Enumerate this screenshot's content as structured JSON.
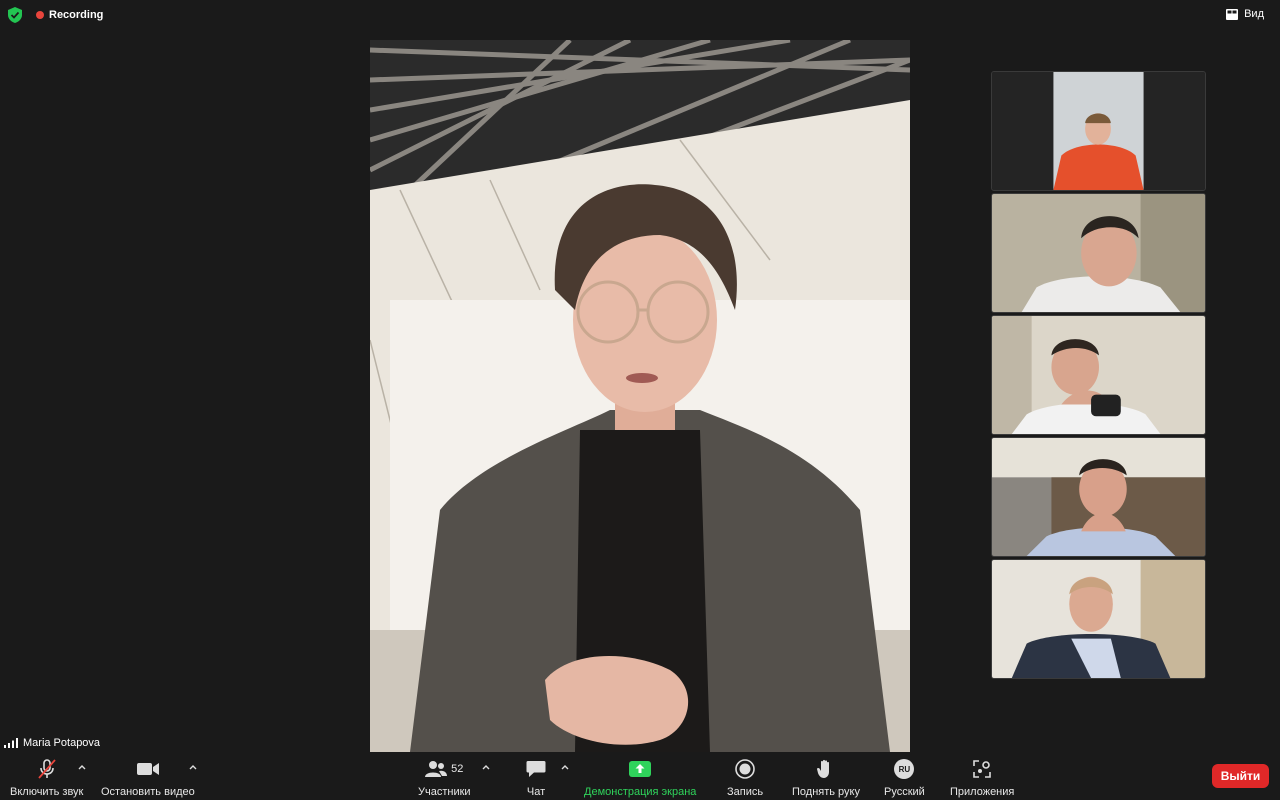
{
  "topbar": {
    "recording_label": "Recording",
    "view_label": "Вид"
  },
  "speaker": {
    "name": "Maria Potapova"
  },
  "participants_count": "52",
  "toolbar": {
    "mute_label": "Включить звук",
    "video_label": "Остановить видео",
    "participants_label": "Участники",
    "chat_label": "Чат",
    "share_label": "Демонстрация экрана",
    "record_label": "Запись",
    "raise_hand_label": "Поднять руку",
    "language_label": "Русский",
    "language_badge": "RU",
    "apps_label": "Приложения",
    "leave_label": "Выйти"
  },
  "colors": {
    "background": "#1a1a1a",
    "recording_dot": "#e8453c",
    "share_green": "#2fd35b",
    "leave_red": "#e02828",
    "shield_green": "#23c552"
  },
  "icons": [
    "shield-icon",
    "record-dot-icon",
    "view-grid-icon",
    "signal-icon",
    "muted-mic-icon",
    "video-camera-icon",
    "participants-icon",
    "chat-icon",
    "share-screen-icon",
    "record-icon",
    "raise-hand-icon",
    "language-icon",
    "apps-icon",
    "chevron-up-icon"
  ]
}
